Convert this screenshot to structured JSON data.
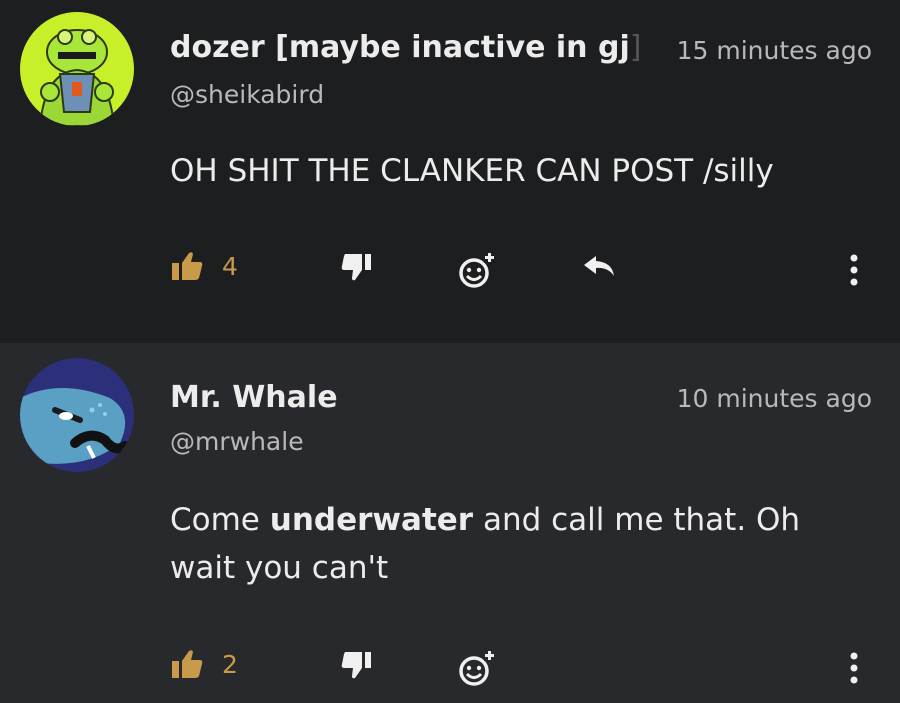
{
  "comments": [
    {
      "author": "dozer [maybe inactive in gj",
      "cursor": "]",
      "handle": "@sheikabird",
      "time": "15 minutes ago",
      "text_plain": "OH SHIT THE CLANKER CAN POST /silly",
      "likes": "4",
      "avatar_desc": "green frog avatar"
    },
    {
      "author": "Mr. Whale",
      "handle": "@mrwhale",
      "time": "10 minutes ago",
      "text_pre": "Come ",
      "text_bold": "underwater",
      "text_post": " and call me that. Oh wait you can't",
      "likes": "2",
      "avatar_desc": "blue whale avatar"
    }
  ],
  "colors": {
    "accent_like": "#c89a4a",
    "bg_dark": "#1d1e20",
    "bg_light": "#28292c",
    "text_main": "#ececec",
    "text_muted": "#b9b9b9"
  },
  "icons": [
    "thumbs-up-icon",
    "thumbs-down-icon",
    "add-reaction-icon",
    "reply-icon",
    "more-vertical-icon"
  ]
}
